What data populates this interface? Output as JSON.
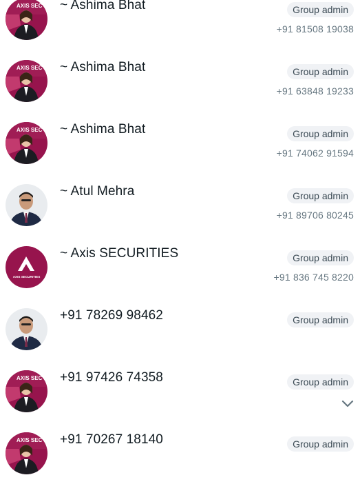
{
  "members": [
    {
      "name": "~ Ashima Bhat",
      "badge": "Group admin",
      "phone": "+91 81508 19038",
      "avatar": "ashima-avatar"
    },
    {
      "name": "~ Ashima Bhat",
      "badge": "Group admin",
      "phone": "+91 63848 19233",
      "avatar": "ashima-avatar"
    },
    {
      "name": "~ Ashima Bhat",
      "badge": "Group admin",
      "phone": "+91 74062 91594",
      "avatar": "ashima-avatar"
    },
    {
      "name": "~ Atul Mehra",
      "badge": "Group admin",
      "phone": "+91 89706 80245",
      "avatar": "atul-avatar"
    },
    {
      "name": "~ Axis SECURITIES",
      "badge": "Group admin",
      "phone": "+91 836 745 8220",
      "avatar": "axis-logo-avatar"
    },
    {
      "name": "+91 78269 98462",
      "badge": "Group admin",
      "avatar": "atul-avatar"
    },
    {
      "name": "+91 97426 74358",
      "badge": "Group admin",
      "avatar": "ashima-avatar",
      "icon": "chevron-down-icon"
    },
    {
      "name": "+91 70267 18140",
      "badge": "Group admin",
      "avatar": "ashima-avatar"
    }
  ],
  "avatar_text": {
    "axis_banner": "AXIS SEC",
    "axis_logo_caption": "AXIS SECURITIES"
  },
  "colors": {
    "axis_brand": "#97144d",
    "badge_bg": "#f0f2f5",
    "name_text": "#111b21",
    "phone_text": "#667781"
  }
}
